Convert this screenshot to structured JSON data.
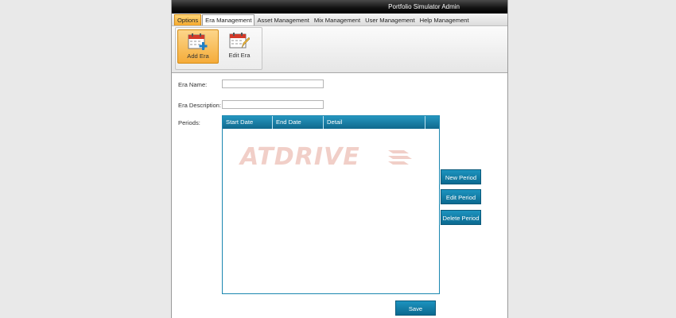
{
  "window": {
    "title": "Portfolio Simulator Admin"
  },
  "menu": {
    "items": [
      "Options",
      "Era Management",
      "Asset Management",
      "Mix Management",
      "User Management",
      "Help Management"
    ]
  },
  "ribbon": {
    "add_era_label": "Add Era",
    "edit_era_label": "Edit Era"
  },
  "form": {
    "era_name_label": "Era Name:",
    "era_name_value": "",
    "era_description_label": "Era Description:",
    "era_description_value": "",
    "periods_label": "Periods:"
  },
  "periods_table": {
    "columns": [
      "Start Date",
      "End Date",
      "Detail"
    ],
    "rows": []
  },
  "watermark": "ATDRIVE",
  "buttons": {
    "new_period": "New Period",
    "edit_period": "Edit Period",
    "delete_period": "Delete Period",
    "save": "Save"
  },
  "colors": {
    "accent": "#10698d",
    "active_tab": "#f5ac3a",
    "watermark": "#f1cfc8"
  }
}
